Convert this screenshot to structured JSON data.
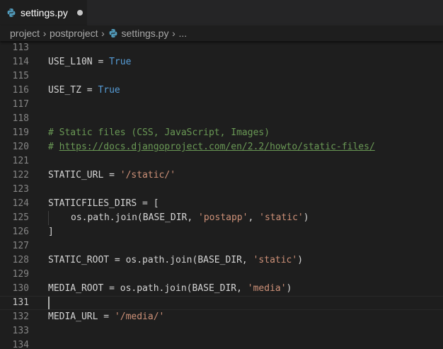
{
  "tab": {
    "file_name": "settings.py",
    "icon": "python-icon",
    "modified": true
  },
  "breadcrumb": {
    "items": [
      "project",
      "postproject"
    ],
    "file": "settings.py",
    "ellipsis": "..."
  },
  "editor": {
    "current_line": 131,
    "lines": [
      {
        "num": "113",
        "tokens": []
      },
      {
        "num": "114",
        "tokens": [
          {
            "t": "USE_L10N = ",
            "c": "plain"
          },
          {
            "t": "True",
            "c": "kw"
          }
        ]
      },
      {
        "num": "115",
        "tokens": []
      },
      {
        "num": "116",
        "tokens": [
          {
            "t": "USE_TZ = ",
            "c": "plain"
          },
          {
            "t": "True",
            "c": "kw"
          }
        ]
      },
      {
        "num": "117",
        "tokens": []
      },
      {
        "num": "118",
        "tokens": []
      },
      {
        "num": "119",
        "tokens": [
          {
            "t": "# Static files (CSS, JavaScript, Images)",
            "c": "comment"
          }
        ]
      },
      {
        "num": "120",
        "tokens": [
          {
            "t": "# ",
            "c": "comment"
          },
          {
            "t": "https://docs.djangoproject.com/en/2.2/howto/static-files/",
            "c": "link"
          }
        ]
      },
      {
        "num": "121",
        "tokens": []
      },
      {
        "num": "122",
        "tokens": [
          {
            "t": "STATIC_URL = ",
            "c": "plain"
          },
          {
            "t": "'/static/'",
            "c": "str"
          }
        ]
      },
      {
        "num": "123",
        "tokens": []
      },
      {
        "num": "124",
        "tokens": [
          {
            "t": "STATICFILES_DIRS = [",
            "c": "plain"
          }
        ]
      },
      {
        "num": "125",
        "indent": true,
        "tokens": [
          {
            "t": "os.path.join(BASE_DIR, ",
            "c": "plain"
          },
          {
            "t": "'postapp'",
            "c": "str"
          },
          {
            "t": ", ",
            "c": "plain"
          },
          {
            "t": "'static'",
            "c": "str"
          },
          {
            "t": ")",
            "c": "plain"
          }
        ]
      },
      {
        "num": "126",
        "tokens": [
          {
            "t": "]",
            "c": "plain"
          }
        ]
      },
      {
        "num": "127",
        "tokens": []
      },
      {
        "num": "128",
        "tokens": [
          {
            "t": "STATIC_ROOT = os.path.join(BASE_DIR, ",
            "c": "plain"
          },
          {
            "t": "'static'",
            "c": "str"
          },
          {
            "t": ")",
            "c": "plain"
          }
        ]
      },
      {
        "num": "129",
        "tokens": []
      },
      {
        "num": "130",
        "tokens": [
          {
            "t": "MEDIA_ROOT = os.path.join(BASE_DIR, ",
            "c": "plain"
          },
          {
            "t": "'media'",
            "c": "str"
          },
          {
            "t": ")",
            "c": "plain"
          }
        ]
      },
      {
        "num": "131",
        "tokens": []
      },
      {
        "num": "132",
        "tokens": [
          {
            "t": "MEDIA_URL = ",
            "c": "plain"
          },
          {
            "t": "'/media/'",
            "c": "str"
          }
        ]
      },
      {
        "num": "133",
        "tokens": []
      },
      {
        "num": "134",
        "tokens": []
      }
    ]
  },
  "colors": {
    "background": "#1e1e1e",
    "tab_bar": "#252526",
    "keyword": "#569cd6",
    "string": "#ce9178",
    "comment": "#6a9955",
    "text": "#d4d4d4",
    "line_number": "#858585"
  }
}
